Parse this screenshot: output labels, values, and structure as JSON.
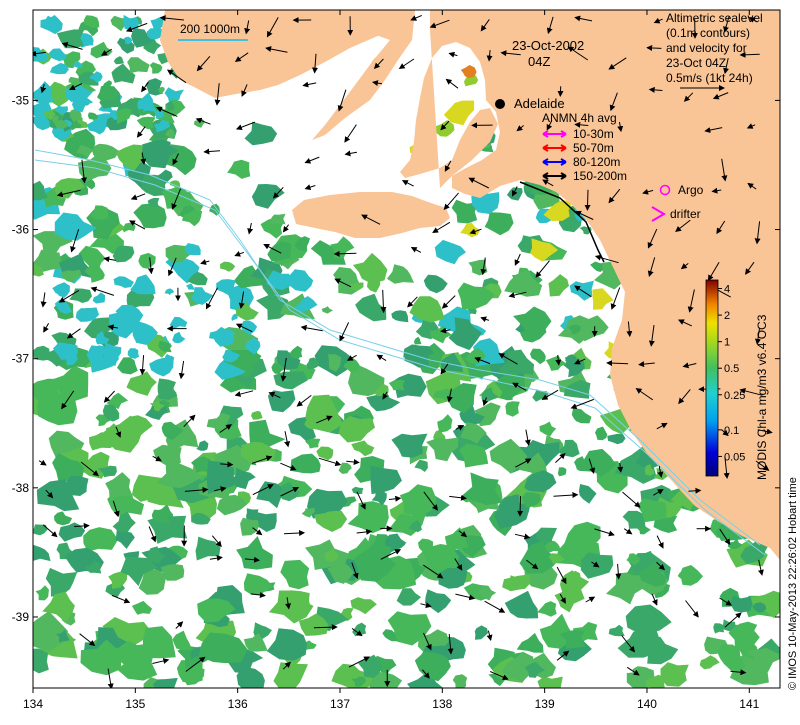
{
  "map": {
    "date_title": "23-Oct-2002",
    "time_title": "04Z",
    "x_ticks": [
      "134",
      "135",
      "136",
      "137",
      "138",
      "139",
      "140",
      "141"
    ],
    "y_ticks": [
      "-35",
      "-36",
      "-37",
      "-38",
      "-39"
    ],
    "extent": {
      "lon": [
        134,
        141.3
      ],
      "lat": [
        -39.55,
        -34.3
      ]
    },
    "scale_bar_label": "200  1000m",
    "place_label": "Adelaide",
    "info_lines": [
      "Altimetric sealevel",
      "(0.1m contours)",
      "and velocity for",
      "23-Oct 04Z",
      "0.5m/s (1kt 24h)"
    ],
    "anmn_title": "ANMN 4h avg",
    "anmn_items": [
      {
        "label": "10-30m",
        "color": "#ff00ff"
      },
      {
        "label": "50-70m",
        "color": "#ff0000"
      },
      {
        "label": "80-120m",
        "color": "#0000ff"
      },
      {
        "label": "150-200m",
        "color": "#000000"
      }
    ],
    "argo_label": "Argo",
    "drifter_label": "drifter",
    "colorbar": {
      "label": "MODIS Chl-a mg/m3 v6.4 OC3",
      "ticks": [
        "4",
        "2",
        "1",
        "0.5",
        "0.25",
        "0.1",
        "0.05"
      ],
      "tick_values": [
        4,
        2,
        1,
        0.5,
        0.25,
        0.1,
        0.05
      ],
      "range": [
        0.03,
        5
      ]
    },
    "credit": "© IMOS 10-May-2013 22:26:02 Hobart time",
    "colors": {
      "land": "#f9c496",
      "chl_green": "#3cae5c",
      "chl_cyan": "#2ec0c8",
      "chl_yellow": "#d8d820",
      "chl_orange": "#e08020",
      "bathy": "#7ad0e8",
      "argo": "#ff00ff"
    }
  }
}
